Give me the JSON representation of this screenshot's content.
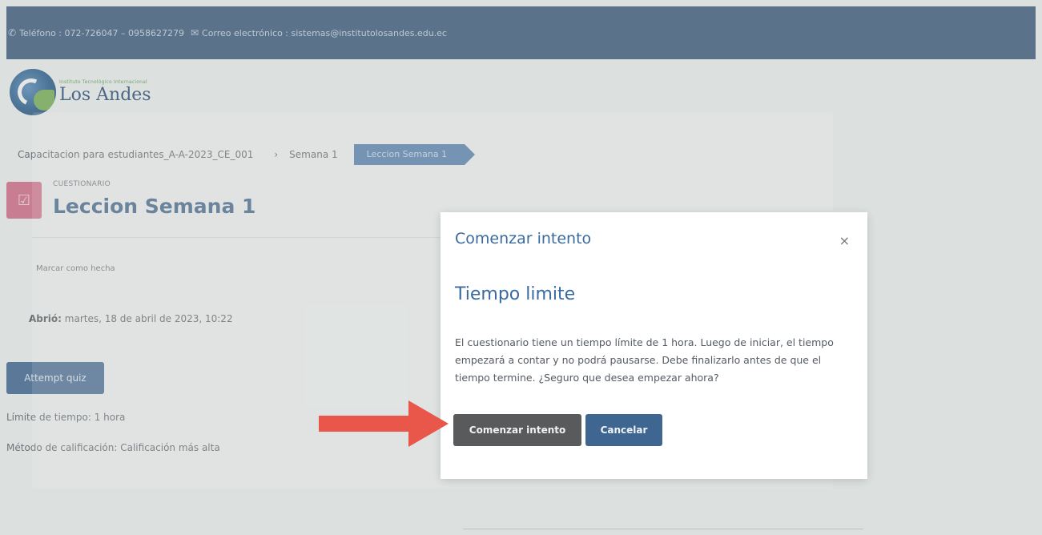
{
  "topbar": {
    "phone_icon": "phone-icon",
    "phone_text": "Teléfono : 072-726047 – 0958627279",
    "mail_icon": "envelope-icon",
    "mail_text": "Correo electrónico : sistemas@institutolosandes.edu.ec"
  },
  "logo": {
    "small_text": "Instituto Tecnológico Internacional",
    "name": "Los Andes"
  },
  "breadcrumb": {
    "items": [
      "Capacitacion para estudiantes_A-A-2023_CE_001",
      "Semana 1"
    ],
    "separator": "›",
    "current": "Leccion Semana 1"
  },
  "activity": {
    "type": "CUESTIONARIO",
    "title": "Leccion Semana 1",
    "mark_done": "Marcar como hecha",
    "opened_label": "Abrió:",
    "opened_value": "martes, 18 de abril de 2023, 10:22",
    "attempt_button": "Attempt quiz",
    "time_limit": "Límite de tiempo: 1 hora",
    "grading_method": "Método de calificación: Calificación más alta"
  },
  "modal": {
    "title": "Comenzar intento",
    "close": "×",
    "heading": "Tiempo limite",
    "body": "El cuestionario tiene un tiempo límite de 1 hora. Luego de iniciar, el tiempo empezará a contar y no podrá pausarse. Debe finalizarlo antes de que el tiempo termine. ¿Seguro que desea empezar ahora?",
    "start_button": "Comenzar intento",
    "cancel_button": "Cancelar"
  },
  "colors": {
    "header_bg": "#3f5f80",
    "accent_blue": "#3f6690",
    "quiz_icon": "#d76d89",
    "arrow_red": "#e8574a"
  }
}
